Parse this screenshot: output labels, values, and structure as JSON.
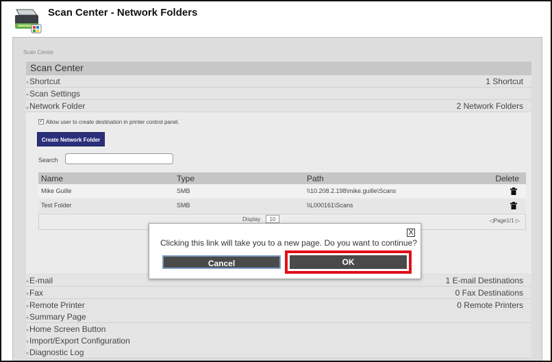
{
  "window": {
    "title": "Scan Center - Network Folders"
  },
  "breadcrumb": "Scan Center",
  "section_title": "Scan Center",
  "rows": {
    "shortcut": {
      "label": "Shortcut",
      "count": "1 Shortcut"
    },
    "scan_settings": {
      "label": "Scan Settings"
    },
    "network_folder": {
      "label": "Network Folder",
      "count": "2 Network Folders"
    },
    "email": {
      "label": "E-mail",
      "count": "1 E-mail Destinations"
    },
    "fax": {
      "label": "Fax",
      "count": "0 Fax Destinations"
    },
    "remote_printer": {
      "label": "Remote Printer",
      "count": "0 Remote Printers"
    },
    "summary_page": {
      "label": "Summary Page"
    },
    "home_screen_button": {
      "label": "Home Screen Button"
    },
    "import_export": {
      "label": "Import/Export Configuration"
    },
    "diagnostic_log": {
      "label": "Diagnostic Log"
    }
  },
  "network_folder": {
    "allow_checkbox_label": "Allow user to create destination in printer control panel.",
    "allow_checked": true,
    "create_button": "Create Network Folder",
    "search_label": "Search",
    "search_value": "",
    "table": {
      "headers": {
        "name": "Name",
        "type": "Type",
        "path": "Path",
        "delete": "Delete"
      },
      "rows": [
        {
          "name": "Mike Guille",
          "type": "SMB",
          "path": "\\\\10.208.2.198\\mike.guille\\Scans"
        },
        {
          "name": "Test Folder",
          "type": "SMB",
          "path": "\\\\L000161\\Scans"
        }
      ],
      "display_label": "Display",
      "display_value": "10",
      "pager": "◁Page1/1 ▷"
    }
  },
  "dialog": {
    "message": "Clicking this link will take you to a new page. Do you want to continue?",
    "close_glyph": "X",
    "cancel_label": "Cancel",
    "ok_label": "OK"
  },
  "colors": {
    "highlight": "#e10e18",
    "create_button": "#2b2f7a",
    "dialog_button": "#4a4a4a"
  }
}
